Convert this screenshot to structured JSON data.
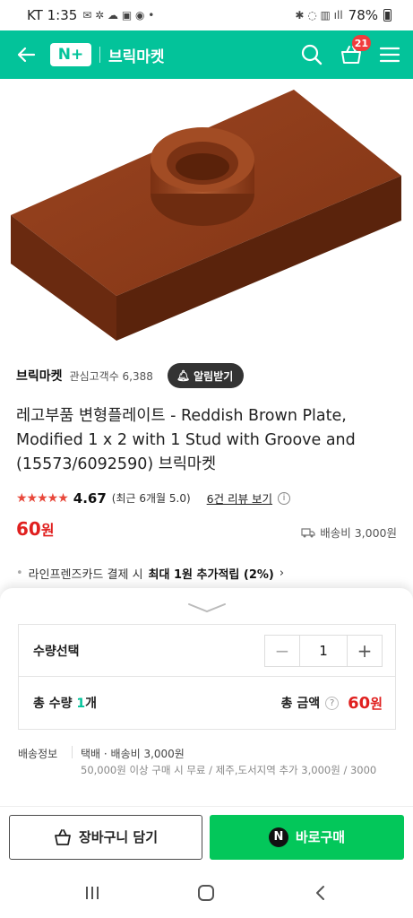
{
  "status_bar": {
    "time": "KT 1:35",
    "battery": "78%"
  },
  "header": {
    "logo": "N+",
    "store_name": "브릭마켓",
    "cart_count": "21",
    "accent_color": "#03c39a"
  },
  "seller": {
    "name": "브릭마켓",
    "followers": "관심고객수 6,388",
    "alarm_label": "알림받기"
  },
  "product": {
    "title": "레고부품 변형플레이트 - Reddish Brown Plate, Modified 1 x 2 with 1 Stud with Groove and (15573/6092590) 브릭마켓",
    "rating": "4.67",
    "rating_recent": "(최근 6개월 5.0)",
    "review_link": "6건 리뷰 보기",
    "price": "60",
    "price_unit": "원",
    "shipping_fee": "배송비 3,000원",
    "promo_prefix": "라인프렌즈카드 결제 시",
    "promo_bold": "최대 1원 추가적립 (2%)",
    "brick_color": "#8a3a1a"
  },
  "option_sheet": {
    "quantity_label": "수량선택",
    "quantity_value": "1",
    "total_qty_label": "총 수량",
    "total_qty_value": "1",
    "total_qty_unit": "개",
    "total_amount_label": "총 금액",
    "total_amount_value": "60",
    "total_amount_unit": "원",
    "shipping_label": "배송정보",
    "shipping_line1": "택배 · 배송비 3,000원",
    "shipping_line2": "50,000원 이상 구매 시 무료 / 제주,도서지역 추가 3,000원 / 3000"
  },
  "actions": {
    "cart_button": "장바구니 담기",
    "buy_button": "바로구매",
    "buy_color": "#03c75a"
  }
}
